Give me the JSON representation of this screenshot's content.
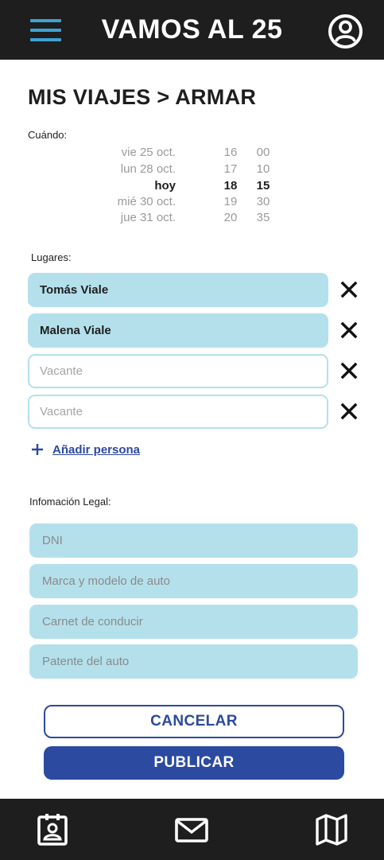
{
  "header": {
    "menu_icon": "hamburger-menu-icon",
    "title": "VAMOS AL 25",
    "profile_icon": "user-profile-icon"
  },
  "page": {
    "title": "MIS VIAJES > ARMAR"
  },
  "when": {
    "label": "Cuándo:",
    "rows": [
      {
        "day": "vie 25 oct.",
        "hour": "16",
        "min": "00",
        "selected": false
      },
      {
        "day": "lun 28 oct.",
        "hour": "17",
        "min": "10",
        "selected": false
      },
      {
        "day": "hoy",
        "hour": "18",
        "min": "15",
        "selected": true
      },
      {
        "day": "mié 30 oct.",
        "hour": "19",
        "min": "30",
        "selected": false
      },
      {
        "day": "jue 31 oct.",
        "hour": "20",
        "min": "35",
        "selected": false
      }
    ]
  },
  "places": {
    "label": "Lugares:",
    "items": [
      {
        "value": "Tomás Viale",
        "placeholder": ""
      },
      {
        "value": "Malena Viale",
        "placeholder": ""
      },
      {
        "value": "",
        "placeholder": "Vacante"
      },
      {
        "value": "",
        "placeholder": "Vacante"
      }
    ],
    "remove_icon": "close-x-icon",
    "add_label": "Añadir persona",
    "add_icon": "plus-icon"
  },
  "legal": {
    "label": "Infomación Legal:",
    "fields": [
      {
        "placeholder": "DNI"
      },
      {
        "placeholder": "Marca y modelo de auto"
      },
      {
        "placeholder": "Carnet de conducir"
      },
      {
        "placeholder": "Patente del auto"
      }
    ]
  },
  "actions": {
    "cancel": "CANCELAR",
    "publish": "PUBLICAR"
  },
  "bottom_nav": {
    "items": [
      {
        "icon": "id-badge-icon"
      },
      {
        "icon": "mail-envelope-icon"
      },
      {
        "icon": "map-icon"
      }
    ]
  },
  "colors": {
    "dark_bar": "#1e1e1e",
    "accent_blue": "#2b4aa0",
    "light_blue_field": "#b4e0ec",
    "menu_icon_blue": "#3ba3d3"
  }
}
